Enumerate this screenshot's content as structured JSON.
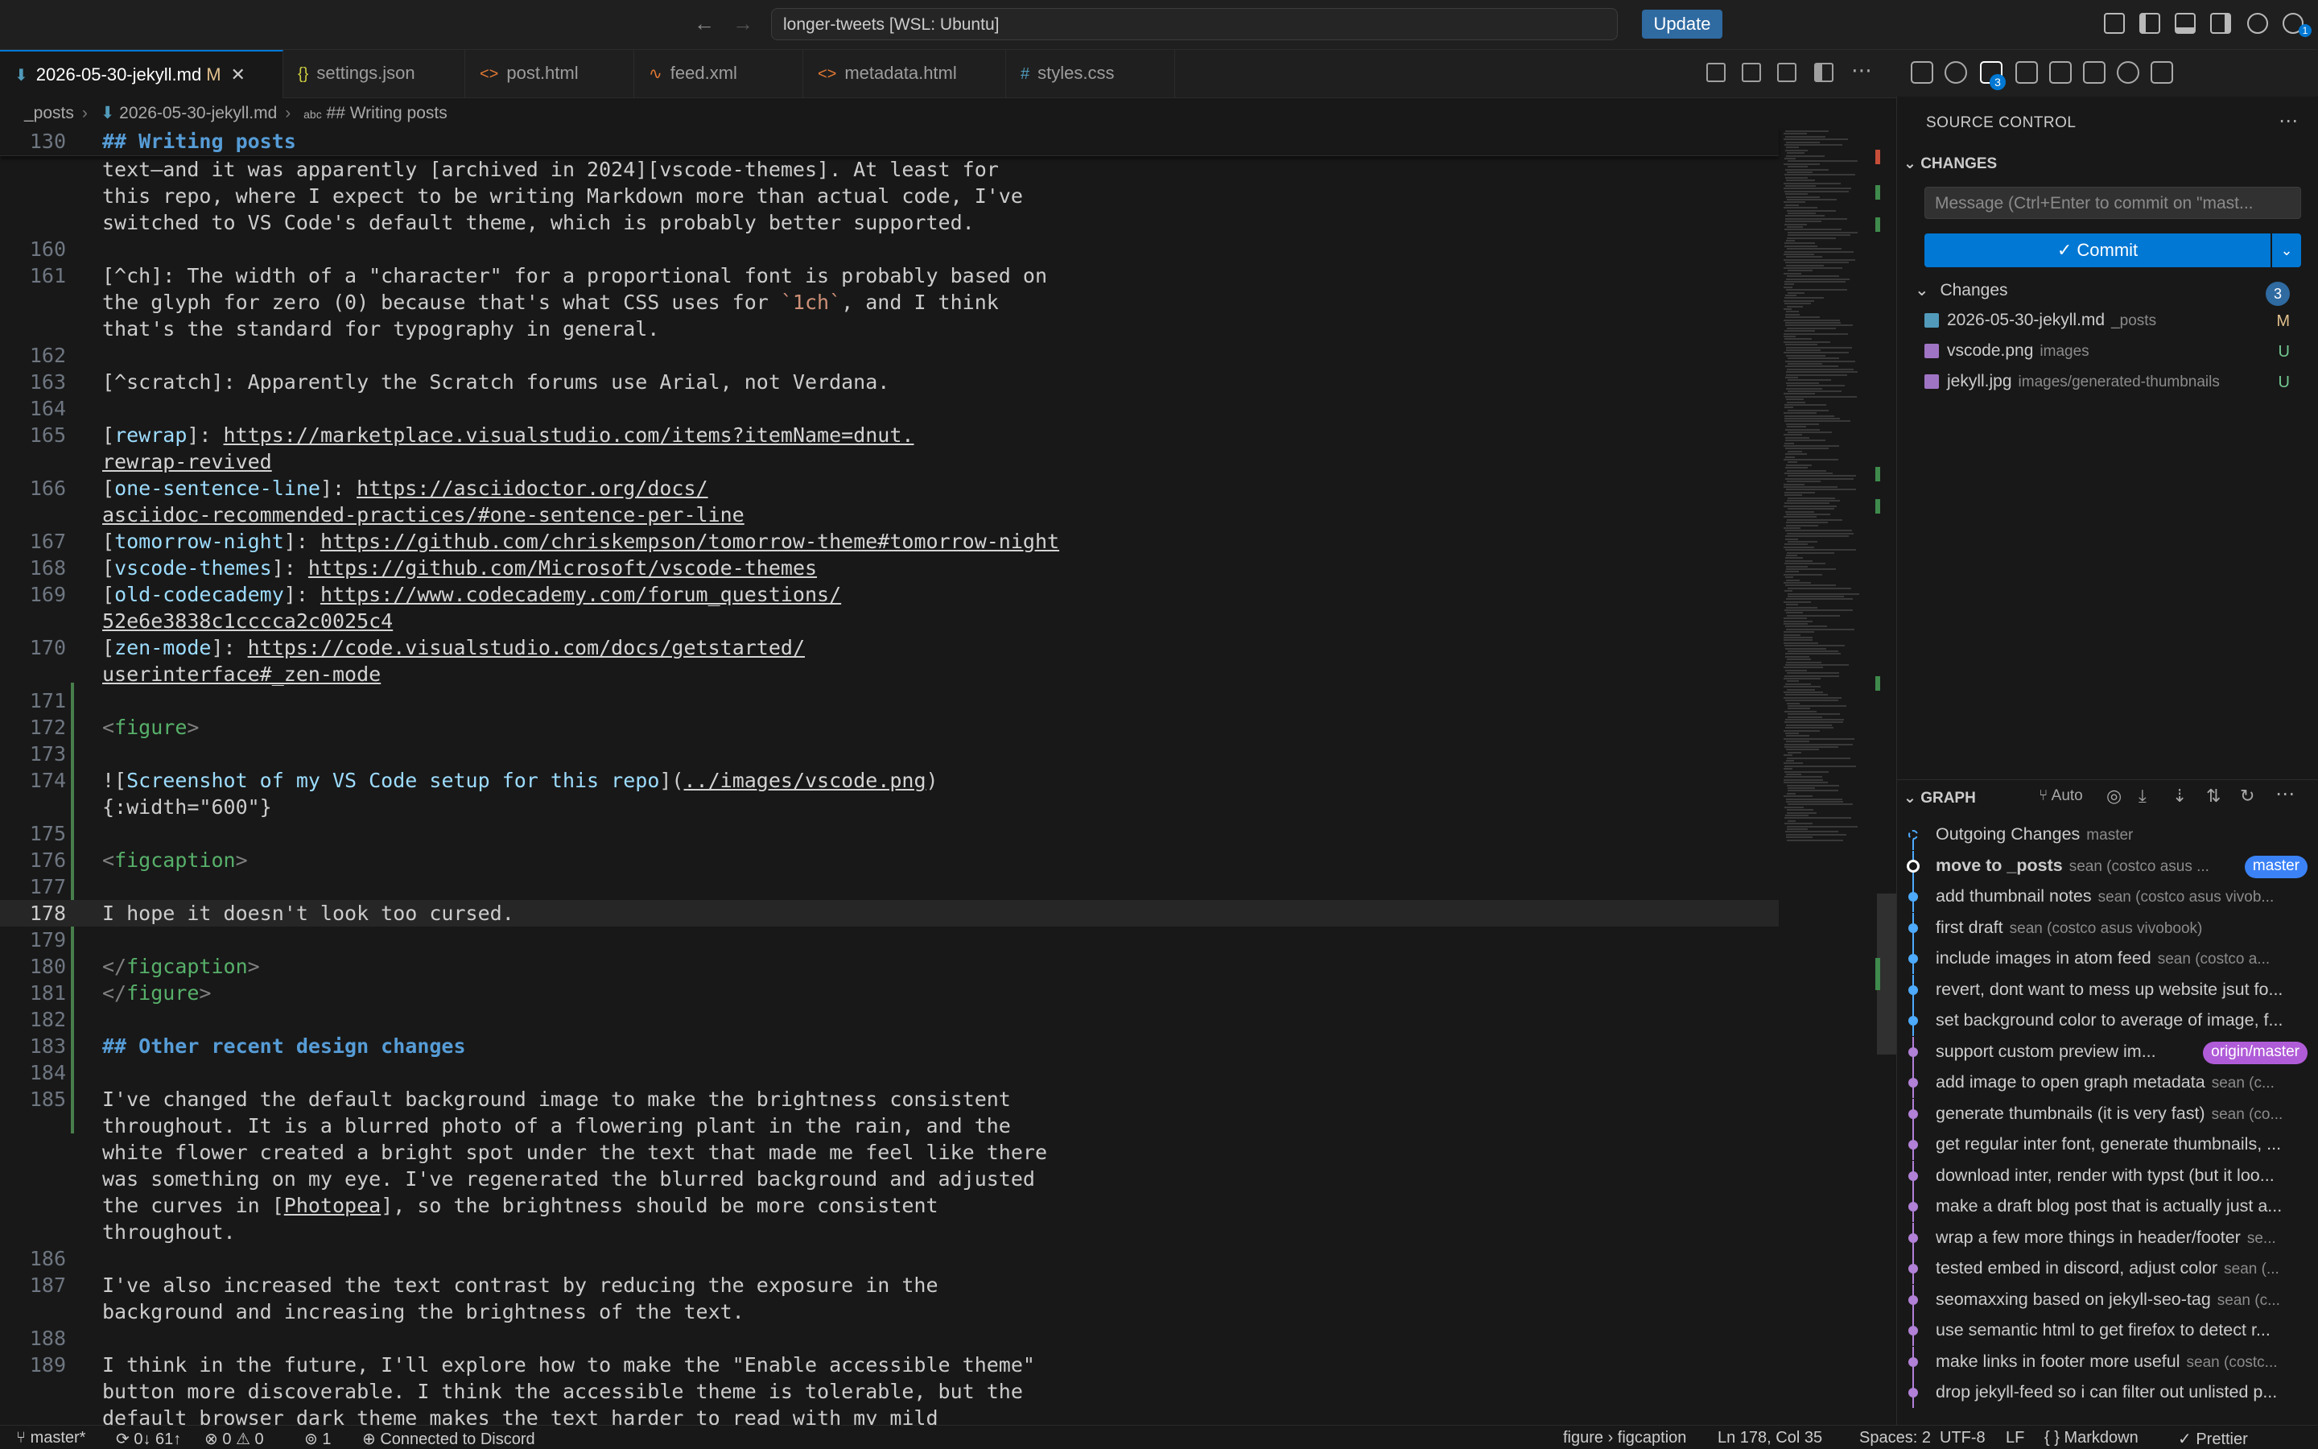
{
  "titlebar": {
    "command_center": "longer-tweets [WSL: Ubuntu]",
    "update_label": "Update",
    "back_icon": "arrow-left-icon",
    "forward_icon": "arrow-right-icon",
    "account_badge": "1"
  },
  "tabs": [
    {
      "icon": "⬇",
      "label": "2026-05-30-jekyll.md",
      "modified": "M",
      "close": "✕",
      "color": "#519aba"
    },
    {
      "icon": "{}",
      "label": "settings.json",
      "color": "#cbcb41"
    },
    {
      "icon": "<>",
      "label": "post.html",
      "color": "#e37933"
    },
    {
      "icon": "∿",
      "label": "feed.xml",
      "color": "#e37933"
    },
    {
      "icon": "<>",
      "label": "metadata.html",
      "color": "#e37933"
    },
    {
      "icon": "#",
      "label": "styles.css",
      "color": "#519aba"
    }
  ],
  "breadcrumb": {
    "folder": "_posts",
    "file": "2026-05-30-jekyll.md",
    "symbol": "## Writing posts"
  },
  "editor": {
    "sticky": {
      "num": "130",
      "text": "## Writing posts"
    },
    "wrapped_top": [
      "text—and it was apparently [archived in 2024][vscode-themes]. At least for",
      "this repo, where I expect to be writing Markdown more than actual code, I've",
      "switched to VS Code's default theme, which is probably better supported."
    ],
    "lines": {
      "l160": "160",
      "l161": "161",
      "l161a_pre": "[^ch]: The width of a \"character\" for a proportional font is probably based on",
      "l161b": "the glyph for zero (0) because that's what CSS uses for ",
      "l161b_code": "`1ch`",
      "l161b_post": ", and I think",
      "l161c": "that's the standard for typography in general.",
      "l162": "162",
      "l163": "163",
      "l163t": "[^scratch]: Apparently the Scratch forums use Arial, not Verdana.",
      "l164": "164",
      "l165": "165",
      "l165_label": "rewrap",
      "l165_url1": "https://marketplace.visualstudio.com/items?itemName=dnut.",
      "l165_url2": "rewrap-revived",
      "l166": "166",
      "l166_label": "one-sentence-line",
      "l166_url1": "https://asciidoctor.org/docs/",
      "l166_url2": "asciidoc-recommended-practices/#one-sentence-per-line",
      "l167": "167",
      "l167_label": "tomorrow-night",
      "l167_url": "https://github.com/chriskempson/tomorrow-theme#tomorrow-night",
      "l168": "168",
      "l168_label": "vscode-themes",
      "l168_url": "https://github.com/Microsoft/vscode-themes",
      "l169": "169",
      "l169_label": "old-codecademy",
      "l169_url1": "https://www.codecademy.com/forum_questions/",
      "l169_url2": "52e6e3838c1cccca2c0025c4",
      "l170": "170",
      "l170_label": "zen-mode",
      "l170_url1": "https://code.visualstudio.com/docs/getstarted/",
      "l170_url2": "userinterface#_zen-mode",
      "l171": "171",
      "l172": "172",
      "l172_tag": "figure",
      "l173": "173",
      "l174": "174",
      "l174_alt": "Screenshot of my VS Code setup for this repo",
      "l174_path": "../images/vscode.png",
      "l174_attr": "{:width=\"600\"}",
      "l175": "175",
      "l176": "176",
      "l176_tag": "figcaption",
      "l177": "177",
      "l178": "178",
      "l178t": "I hope it doesn't look too cursed.",
      "l179": "179",
      "l180": "180",
      "l180_tag": "figcaption",
      "l181": "181",
      "l181_tag": "figure",
      "l182": "182",
      "l183": "183",
      "l183t": "## Other recent design changes",
      "l184": "184",
      "l185": "185",
      "l185a": "I've changed the default background image to make the brightness consistent",
      "l185b": "throughout. It is a blurred photo of a flowering plant in the rain, and the",
      "l185c": "white flower created a bright spot under the text that made me feel like there",
      "l185d": "was something on my eye. I've regenerated the blurred background and adjusted",
      "l185e_pre": "the curves in [",
      "l185e_link": "Photopea",
      "l185e_post": "], so the brightness should be more consistent",
      "l185f": "throughout.",
      "l186": "186",
      "l187": "187",
      "l187a": "I've also increased the text contrast by reducing the exposure in the",
      "l187b": "background and increasing the brightness of the text.",
      "l188": "188",
      "l189": "189",
      "l189a": "I think in the future, I'll explore how to make the \"Enable accessible theme\"",
      "l189b": "button more discoverable. I think the accessible theme is tolerable, but the",
      "l189c": "default browser dark theme makes the text harder to read with my mild"
    }
  },
  "source_control": {
    "title": "SOURCE CONTROL",
    "section_changes": "CHANGES",
    "message_placeholder": "Message (Ctrl+Enter to commit on \"mast...",
    "commit_label": "✓  Commit",
    "changes_group": "Changes",
    "changes_count": "3",
    "files": [
      {
        "name": "2026-05-30-jekyll.md",
        "path": "_posts",
        "status": "M",
        "status_color": "#e2c08d",
        "icon_color": "#519aba"
      },
      {
        "name": "vscode.png",
        "path": "images",
        "status": "U",
        "status_color": "#73c991",
        "icon_color": "#a074c4"
      },
      {
        "name": "jekyll.jpg",
        "path": "images/generated-thumbnails",
        "status": "U",
        "status_color": "#73c991",
        "icon_color": "#a074c4"
      }
    ]
  },
  "graph": {
    "title": "GRAPH",
    "auto_label": "Auto",
    "commits": [
      {
        "msg": "Outgoing Changes",
        "author": "master",
        "dot": "outgoing",
        "color": "#4daafc"
      },
      {
        "msg": "move to _posts",
        "author": "sean (costco asus ...",
        "bold": true,
        "badge": "master",
        "badge_color": "#3b82f6",
        "dot": "head",
        "color": "#4daafc"
      },
      {
        "msg": "add thumbnail notes",
        "author": "sean (costco asus vivob...",
        "color": "#4daafc"
      },
      {
        "msg": "first draft",
        "author": "sean (costco asus vivobook)",
        "color": "#4daafc"
      },
      {
        "msg": "include images in atom feed",
        "author": "sean (costco a...",
        "color": "#4daafc"
      },
      {
        "msg": "revert, dont want to mess up website jsut fo...",
        "author": "",
        "color": "#4daafc"
      },
      {
        "msg": "set background color to average of image, f...",
        "author": "",
        "color": "#4daafc"
      },
      {
        "msg": "support custom preview im...",
        "author": "",
        "badge": "origin/master",
        "badge_color": "#b05cd8",
        "color": "#b180d7"
      },
      {
        "msg": "add image to open graph metadata",
        "author": "sean (c...",
        "color": "#b180d7"
      },
      {
        "msg": "generate thumbnails (it is very fast)",
        "author": "sean (co...",
        "color": "#b180d7"
      },
      {
        "msg": "get regular inter font, generate thumbnails, ...",
        "author": "",
        "color": "#b180d7"
      },
      {
        "msg": "download inter, render with typst (but it loo...",
        "author": "",
        "color": "#b180d7"
      },
      {
        "msg": "make a draft blog post that is actually just a...",
        "author": "",
        "color": "#b180d7"
      },
      {
        "msg": "wrap a few more things in header/footer",
        "author": "se...",
        "color": "#b180d7"
      },
      {
        "msg": "tested embed in discord, adjust color",
        "author": "sean (...",
        "color": "#b180d7"
      },
      {
        "msg": "seomaxxing based on jekyll-seo-tag",
        "author": "sean (c...",
        "color": "#b180d7"
      },
      {
        "msg": "use semantic html to get firefox to detect r...",
        "author": "",
        "color": "#b180d7"
      },
      {
        "msg": "make links in footer more useful",
        "author": "sean (costc...",
        "color": "#b180d7"
      },
      {
        "msg": "drop jekyll-feed so i can filter out unlisted p...",
        "author": "",
        "color": "#b180d7"
      }
    ]
  },
  "statusbar": {
    "branch": "master*",
    "sync": "0↓ 61↑",
    "problems": "⊗ 0  ⚠ 0",
    "ports": "1",
    "discord": "Connected to Discord",
    "breadcrumb": "figure › figcaption",
    "position": "Ln 178, Col 35",
    "spaces": "Spaces: 2",
    "encoding": "UTF-8",
    "eol": "LF",
    "language": "{ } Markdown",
    "formatter": "✓ Prettier"
  }
}
